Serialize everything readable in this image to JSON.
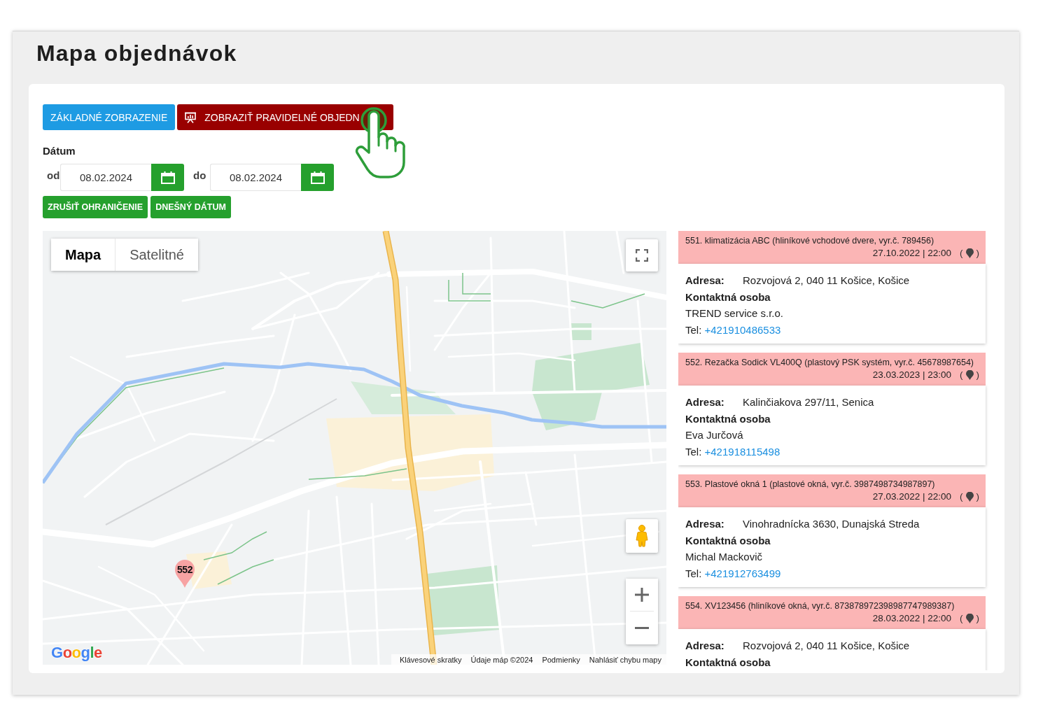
{
  "page": {
    "title": "Mapa objednávok"
  },
  "toolbar": {
    "buttons": [
      {
        "kind": "info",
        "label": "ZÁKLADNÉ ZOBRAZENIE"
      },
      {
        "kind": "danger",
        "label": "ZOBRAZIŤ PRAVIDELNÉ OBJEDN"
      }
    ]
  },
  "date_filter": {
    "label": "Dátum",
    "from_label": "od",
    "from_value": "08.02.2024",
    "to_label": "do",
    "to_value": "08.02.2024",
    "buttons": [
      "ZRUŠIŤ OHRANIČENIE",
      "DNEŠNÝ DÁTUM"
    ]
  },
  "map": {
    "type_tabs": [
      {
        "label": "Mapa",
        "selected": true
      },
      {
        "label": "Satelitné",
        "selected": false
      }
    ],
    "markers": [
      {
        "label": "552"
      }
    ],
    "logo": "Google",
    "footer_links": [
      "Klávesové skratky",
      "Údaje máp ©2024",
      "Podmienky",
      "Nahlásiť chybu mapy"
    ]
  },
  "orders": [
    {
      "title": "551. klimatizácia ABC (hliníkové vchodové dvere, vyr.č. 789456)",
      "datetime": "27.10.2022 | 22:00",
      "map_link": {
        "open": "(",
        "close": ")"
      },
      "address_label": "Adresa:",
      "address": "Rozvojová 2, 040 11 Košice, Košice",
      "contact_label": "Kontaktná osoba",
      "contact": "TREND service s.r.o.",
      "phone_label": "Tel:",
      "phone": "+421910486533"
    },
    {
      "title": "552. Rezačka Sodick VL400Q (plastový PSK systém, vyr.č. 45678987654)",
      "datetime": "23.03.2023 | 23:00",
      "map_link": {
        "open": "(",
        "close": ")"
      },
      "address_label": "Adresa:",
      "address": "Kalinčiakova 297/11, Senica",
      "contact_label": "Kontaktná osoba",
      "contact": "Eva Jurčová",
      "phone_label": "Tel:",
      "phone": "+421918115498"
    },
    {
      "title": "553. Plastové okná 1 (plastové okná, vyr.č. 3987498734987897)",
      "datetime": "27.03.2022 | 22:00",
      "map_link": {
        "open": "(",
        "close": ")"
      },
      "address_label": "Adresa:",
      "address": "Vinohradnícka 3630, Dunajská Streda",
      "contact_label": "Kontaktná osoba",
      "contact": "Michal Mackovič",
      "phone_label": "Tel:",
      "phone": "+421912763499"
    },
    {
      "title": "554. XV123456 (hliníkové okná, vyr.č. 873878972398987747989387)",
      "datetime": "28.03.2022 | 22:00",
      "map_link": {
        "open": "(",
        "close": ")"
      },
      "address_label": "Adresa:",
      "address": "Rozvojová 2, 040 11 Košice, Košice",
      "contact_label": "Kontaktná osoba"
    }
  ]
}
